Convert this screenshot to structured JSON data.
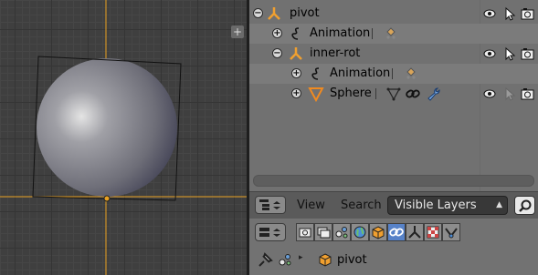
{
  "outliner": {
    "rows": [
      {
        "label": "pivot",
        "icon": "empty-axes-icon",
        "expander": "−"
      },
      {
        "label": "Animation",
        "icon": "animation-icon",
        "expander": "+"
      },
      {
        "label": "inner-rot",
        "icon": "empty-axes-icon",
        "expander": "−"
      },
      {
        "label": "Animation",
        "icon": "animation-icon",
        "expander": "+"
      },
      {
        "label": "Sphere",
        "icon": "mesh-object-icon",
        "expander": "+"
      }
    ]
  },
  "outliner_header": {
    "view_label": "View",
    "search_label": "Search",
    "display_mode": "Visible Layers"
  },
  "properties": {
    "context_label": "pivot"
  },
  "colors": {
    "accent_blue": "#5782c8",
    "object_orange": "#f0a030",
    "viewport_bg": "#3f3f3f"
  }
}
